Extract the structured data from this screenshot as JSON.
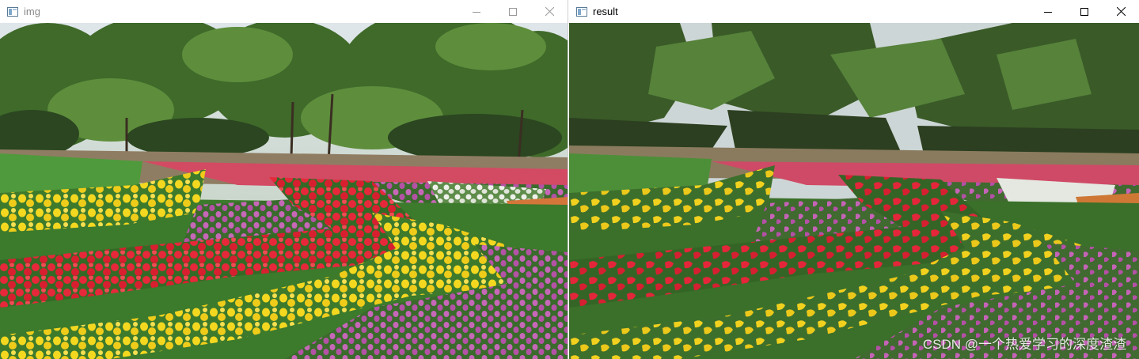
{
  "windows": [
    {
      "title": "img",
      "title_color": "#888888"
    },
    {
      "title": "result",
      "title_color": "#000000"
    }
  ],
  "watermark": "CSDN @一个热爱学习的深度渣渣",
  "icons": {
    "app": "app-window-icon",
    "minimize": "minimize-icon",
    "maximize": "maximize-icon",
    "close": "close-icon"
  },
  "colors": {
    "sky": "#c9d6de",
    "tree_dark": "#2f4a24",
    "tree_mid": "#4e7d33",
    "grass": "#4f8f3a",
    "tulip_yellow": "#f2d21e",
    "tulip_red": "#e3283a",
    "tulip_pink": "#c765b8",
    "tulip_white": "#e8ece4"
  }
}
